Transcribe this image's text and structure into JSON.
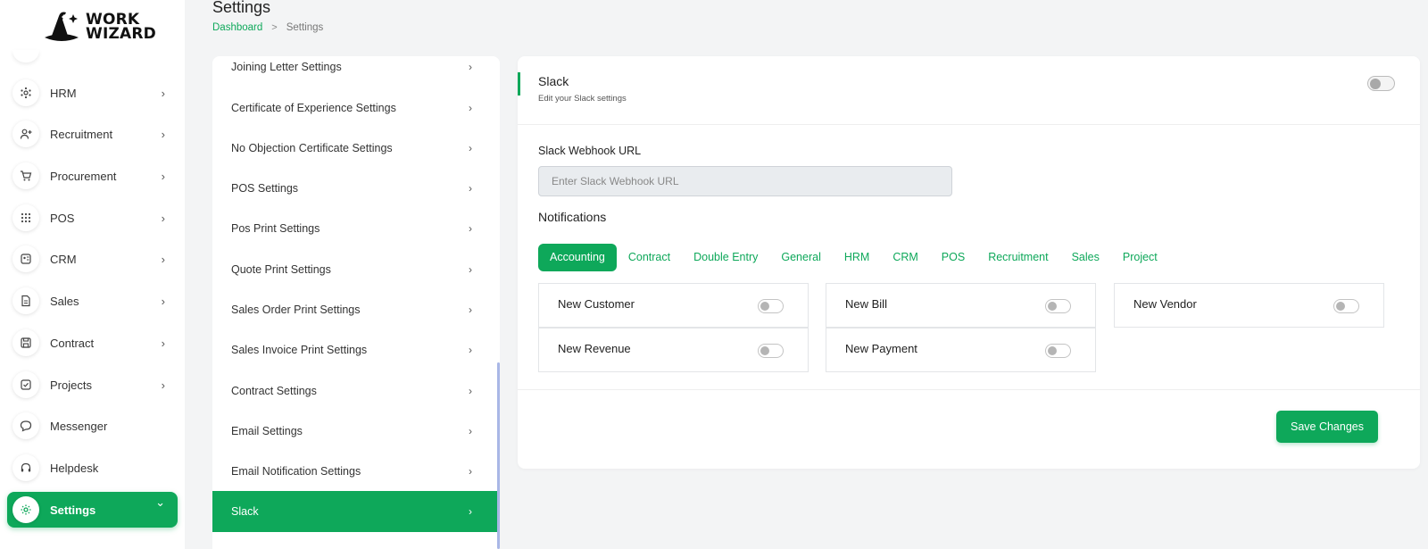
{
  "logo": {
    "line1": "WORK",
    "line2": "WIZARD"
  },
  "sidebar": {
    "items": [
      {
        "label": "HRM",
        "icon": "hrm-icon",
        "has_chevron": true
      },
      {
        "label": "Recruitment",
        "icon": "user-plus-icon",
        "has_chevron": true
      },
      {
        "label": "Procurement",
        "icon": "cart-icon",
        "has_chevron": true
      },
      {
        "label": "POS",
        "icon": "grid-icon",
        "has_chevron": true
      },
      {
        "label": "CRM",
        "icon": "crm-icon",
        "has_chevron": true
      },
      {
        "label": "Sales",
        "icon": "document-icon",
        "has_chevron": true
      },
      {
        "label": "Contract",
        "icon": "save-icon",
        "has_chevron": true
      },
      {
        "label": "Projects",
        "icon": "checkbox-icon",
        "has_chevron": true
      },
      {
        "label": "Messenger",
        "icon": "chat-icon",
        "has_chevron": false
      },
      {
        "label": "Helpdesk",
        "icon": "headset-icon",
        "has_chevron": false
      },
      {
        "label": "Settings",
        "icon": "gear-icon",
        "has_chevron": true,
        "active": true
      }
    ],
    "chevron_right": "›",
    "chevron_down": "⌄"
  },
  "header": {
    "title": "Settings",
    "breadcrumb": {
      "home": "Dashboard",
      "separator": ">",
      "current": "Settings"
    }
  },
  "settings_menu": {
    "items": [
      "Joining Letter Settings",
      "Certificate of Experience Settings",
      "No Objection Certificate Settings",
      "POS Settings",
      "Pos Print Settings",
      "Quote Print Settings",
      "Sales Order Print Settings",
      "Sales Invoice Print Settings",
      "Contract Settings",
      "Email Settings",
      "Email Notification Settings",
      "Slack"
    ],
    "active": "Slack",
    "chevron": "›"
  },
  "slack": {
    "title": "Slack",
    "subtitle": "Edit your Slack settings",
    "enabled": false,
    "webhook_label": "Slack Webhook URL",
    "webhook_placeholder": "Enter Slack Webhook URL",
    "webhook_value": "",
    "notifications_title": "Notifications",
    "tabs": [
      "Accounting",
      "Contract",
      "Double Entry",
      "General",
      "HRM",
      "CRM",
      "POS",
      "Recruitment",
      "Sales",
      "Project"
    ],
    "active_tab": "Accounting",
    "notifications": [
      {
        "label": "New Customer",
        "enabled": false
      },
      {
        "label": "New Bill",
        "enabled": false
      },
      {
        "label": "New Vendor",
        "enabled": false
      },
      {
        "label": "New Revenue",
        "enabled": false
      },
      {
        "label": "New Payment",
        "enabled": false
      }
    ],
    "save_label": "Save Changes"
  },
  "colors": {
    "accent": "#0ea85a",
    "background": "#f3f4f5",
    "scrollbar": "#a9b7e6"
  }
}
